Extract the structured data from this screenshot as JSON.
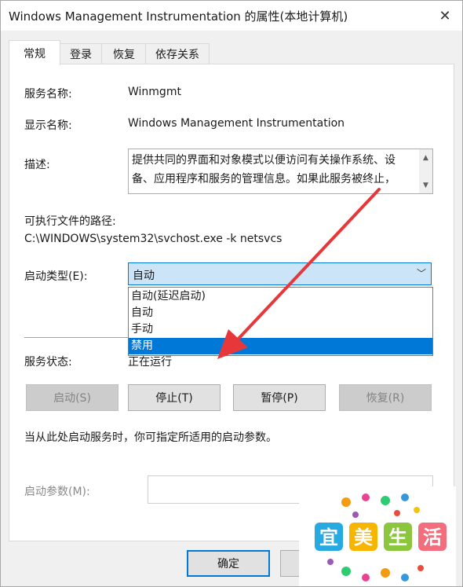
{
  "window": {
    "title": "Windows Management Instrumentation 的属性(本地计算机)",
    "close_glyph": "✕"
  },
  "tabs": [
    {
      "label": "常规",
      "active": true
    },
    {
      "label": "登录",
      "active": false
    },
    {
      "label": "恢复",
      "active": false
    },
    {
      "label": "依存关系",
      "active": false
    }
  ],
  "general": {
    "service_name_label": "服务名称:",
    "service_name": "Winmgmt",
    "display_name_label": "显示名称:",
    "display_name": "Windows Management Instrumentation",
    "description_label": "描述:",
    "description": "提供共同的界面和对象模式以便访问有关操作系统、设备、应用程序和服务的管理信息。如果此服务被终止，",
    "exe_path_label": "可执行文件的路径:",
    "exe_path": "C:\\WINDOWS\\system32\\svchost.exe -k netsvcs",
    "startup_type_label": "启动类型(E):",
    "startup_type_value": "自动",
    "startup_options": [
      "自动(延迟启动)",
      "自动",
      "手动",
      "禁用"
    ],
    "startup_highlighted": "禁用",
    "service_status_label": "服务状态:",
    "service_status": "正在运行",
    "buttons": {
      "start": "启动(S)",
      "stop": "停止(T)",
      "pause": "暂停(P)",
      "resume": "恢复(R)"
    },
    "hint": "当从此处启动服务时，你可指定所适用的启动参数。",
    "start_params_label": "启动参数(M):",
    "start_params_value": ""
  },
  "footer": {
    "ok": "确定",
    "cancel": ""
  },
  "watermark": {
    "text": "宜美生活"
  },
  "colors": {
    "accent": "#0078d7",
    "arrow": "#e8373b",
    "selected_bg": "#cce4f7"
  }
}
